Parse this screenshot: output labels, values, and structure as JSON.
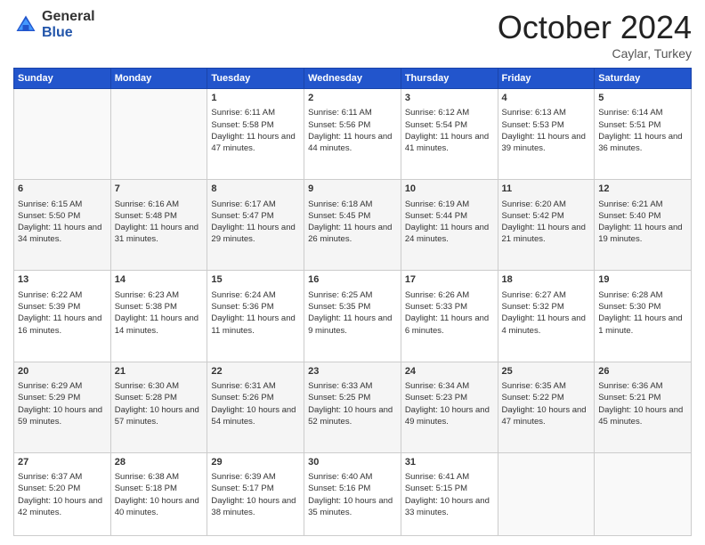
{
  "header": {
    "logo_general": "General",
    "logo_blue": "Blue",
    "month_title": "October 2024",
    "location": "Caylar, Turkey"
  },
  "days_of_week": [
    "Sunday",
    "Monday",
    "Tuesday",
    "Wednesday",
    "Thursday",
    "Friday",
    "Saturday"
  ],
  "weeks": [
    [
      {
        "day": "",
        "sunrise": "",
        "sunset": "",
        "daylight": ""
      },
      {
        "day": "",
        "sunrise": "",
        "sunset": "",
        "daylight": ""
      },
      {
        "day": "1",
        "sunrise": "Sunrise: 6:11 AM",
        "sunset": "Sunset: 5:58 PM",
        "daylight": "Daylight: 11 hours and 47 minutes."
      },
      {
        "day": "2",
        "sunrise": "Sunrise: 6:11 AM",
        "sunset": "Sunset: 5:56 PM",
        "daylight": "Daylight: 11 hours and 44 minutes."
      },
      {
        "day": "3",
        "sunrise": "Sunrise: 6:12 AM",
        "sunset": "Sunset: 5:54 PM",
        "daylight": "Daylight: 11 hours and 41 minutes."
      },
      {
        "day": "4",
        "sunrise": "Sunrise: 6:13 AM",
        "sunset": "Sunset: 5:53 PM",
        "daylight": "Daylight: 11 hours and 39 minutes."
      },
      {
        "day": "5",
        "sunrise": "Sunrise: 6:14 AM",
        "sunset": "Sunset: 5:51 PM",
        "daylight": "Daylight: 11 hours and 36 minutes."
      }
    ],
    [
      {
        "day": "6",
        "sunrise": "Sunrise: 6:15 AM",
        "sunset": "Sunset: 5:50 PM",
        "daylight": "Daylight: 11 hours and 34 minutes."
      },
      {
        "day": "7",
        "sunrise": "Sunrise: 6:16 AM",
        "sunset": "Sunset: 5:48 PM",
        "daylight": "Daylight: 11 hours and 31 minutes."
      },
      {
        "day": "8",
        "sunrise": "Sunrise: 6:17 AM",
        "sunset": "Sunset: 5:47 PM",
        "daylight": "Daylight: 11 hours and 29 minutes."
      },
      {
        "day": "9",
        "sunrise": "Sunrise: 6:18 AM",
        "sunset": "Sunset: 5:45 PM",
        "daylight": "Daylight: 11 hours and 26 minutes."
      },
      {
        "day": "10",
        "sunrise": "Sunrise: 6:19 AM",
        "sunset": "Sunset: 5:44 PM",
        "daylight": "Daylight: 11 hours and 24 minutes."
      },
      {
        "day": "11",
        "sunrise": "Sunrise: 6:20 AM",
        "sunset": "Sunset: 5:42 PM",
        "daylight": "Daylight: 11 hours and 21 minutes."
      },
      {
        "day": "12",
        "sunrise": "Sunrise: 6:21 AM",
        "sunset": "Sunset: 5:40 PM",
        "daylight": "Daylight: 11 hours and 19 minutes."
      }
    ],
    [
      {
        "day": "13",
        "sunrise": "Sunrise: 6:22 AM",
        "sunset": "Sunset: 5:39 PM",
        "daylight": "Daylight: 11 hours and 16 minutes."
      },
      {
        "day": "14",
        "sunrise": "Sunrise: 6:23 AM",
        "sunset": "Sunset: 5:38 PM",
        "daylight": "Daylight: 11 hours and 14 minutes."
      },
      {
        "day": "15",
        "sunrise": "Sunrise: 6:24 AM",
        "sunset": "Sunset: 5:36 PM",
        "daylight": "Daylight: 11 hours and 11 minutes."
      },
      {
        "day": "16",
        "sunrise": "Sunrise: 6:25 AM",
        "sunset": "Sunset: 5:35 PM",
        "daylight": "Daylight: 11 hours and 9 minutes."
      },
      {
        "day": "17",
        "sunrise": "Sunrise: 6:26 AM",
        "sunset": "Sunset: 5:33 PM",
        "daylight": "Daylight: 11 hours and 6 minutes."
      },
      {
        "day": "18",
        "sunrise": "Sunrise: 6:27 AM",
        "sunset": "Sunset: 5:32 PM",
        "daylight": "Daylight: 11 hours and 4 minutes."
      },
      {
        "day": "19",
        "sunrise": "Sunrise: 6:28 AM",
        "sunset": "Sunset: 5:30 PM",
        "daylight": "Daylight: 11 hours and 1 minute."
      }
    ],
    [
      {
        "day": "20",
        "sunrise": "Sunrise: 6:29 AM",
        "sunset": "Sunset: 5:29 PM",
        "daylight": "Daylight: 10 hours and 59 minutes."
      },
      {
        "day": "21",
        "sunrise": "Sunrise: 6:30 AM",
        "sunset": "Sunset: 5:28 PM",
        "daylight": "Daylight: 10 hours and 57 minutes."
      },
      {
        "day": "22",
        "sunrise": "Sunrise: 6:31 AM",
        "sunset": "Sunset: 5:26 PM",
        "daylight": "Daylight: 10 hours and 54 minutes."
      },
      {
        "day": "23",
        "sunrise": "Sunrise: 6:33 AM",
        "sunset": "Sunset: 5:25 PM",
        "daylight": "Daylight: 10 hours and 52 minutes."
      },
      {
        "day": "24",
        "sunrise": "Sunrise: 6:34 AM",
        "sunset": "Sunset: 5:23 PM",
        "daylight": "Daylight: 10 hours and 49 minutes."
      },
      {
        "day": "25",
        "sunrise": "Sunrise: 6:35 AM",
        "sunset": "Sunset: 5:22 PM",
        "daylight": "Daylight: 10 hours and 47 minutes."
      },
      {
        "day": "26",
        "sunrise": "Sunrise: 6:36 AM",
        "sunset": "Sunset: 5:21 PM",
        "daylight": "Daylight: 10 hours and 45 minutes."
      }
    ],
    [
      {
        "day": "27",
        "sunrise": "Sunrise: 6:37 AM",
        "sunset": "Sunset: 5:20 PM",
        "daylight": "Daylight: 10 hours and 42 minutes."
      },
      {
        "day": "28",
        "sunrise": "Sunrise: 6:38 AM",
        "sunset": "Sunset: 5:18 PM",
        "daylight": "Daylight: 10 hours and 40 minutes."
      },
      {
        "day": "29",
        "sunrise": "Sunrise: 6:39 AM",
        "sunset": "Sunset: 5:17 PM",
        "daylight": "Daylight: 10 hours and 38 minutes."
      },
      {
        "day": "30",
        "sunrise": "Sunrise: 6:40 AM",
        "sunset": "Sunset: 5:16 PM",
        "daylight": "Daylight: 10 hours and 35 minutes."
      },
      {
        "day": "31",
        "sunrise": "Sunrise: 6:41 AM",
        "sunset": "Sunset: 5:15 PM",
        "daylight": "Daylight: 10 hours and 33 minutes."
      },
      {
        "day": "",
        "sunrise": "",
        "sunset": "",
        "daylight": ""
      },
      {
        "day": "",
        "sunrise": "",
        "sunset": "",
        "daylight": ""
      }
    ]
  ]
}
